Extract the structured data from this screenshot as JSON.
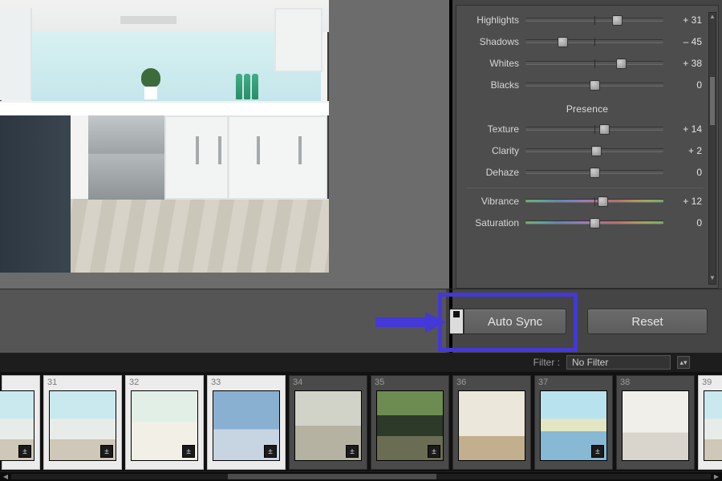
{
  "panel": {
    "groups": {
      "tone": {
        "highlights": {
          "label": "Highlights",
          "value": "+ 31",
          "pct": 66
        },
        "shadows": {
          "label": "Shadows",
          "value": "– 45",
          "pct": 27
        },
        "whites": {
          "label": "Whites",
          "value": "+ 38",
          "pct": 69
        },
        "blacks": {
          "label": "Blacks",
          "value": "0",
          "pct": 50
        }
      },
      "presence_title": "Presence",
      "presence": {
        "texture": {
          "label": "Texture",
          "value": "+ 14",
          "pct": 57
        },
        "clarity": {
          "label": "Clarity",
          "value": "+ 2",
          "pct": 51
        },
        "dehaze": {
          "label": "Dehaze",
          "value": "0",
          "pct": 50
        }
      },
      "color": {
        "vibrance": {
          "label": "Vibrance",
          "value": "+ 12",
          "pct": 56
        },
        "saturation": {
          "label": "Saturation",
          "value": "0",
          "pct": 50
        }
      }
    }
  },
  "actions": {
    "auto_sync": "Auto Sync",
    "reset": "Reset"
  },
  "filter": {
    "label": "Filter :",
    "value": "No Filter"
  },
  "filmstrip": {
    "items": [
      {
        "num": "",
        "sel": true,
        "scene": "sc-interior",
        "badge": true
      },
      {
        "num": "31",
        "sel": true,
        "scene": "sc-interior",
        "badge": true
      },
      {
        "num": "32",
        "sel": true,
        "scene": "sc-living",
        "badge": true
      },
      {
        "num": "33",
        "sel": true,
        "scene": "sc-blue",
        "badge": true
      },
      {
        "num": "34",
        "sel": false,
        "scene": "sc-room",
        "badge": true
      },
      {
        "num": "35",
        "sel": false,
        "scene": "sc-ext",
        "badge": true
      },
      {
        "num": "36",
        "sel": false,
        "scene": "sc-gallery",
        "badge": false
      },
      {
        "num": "37",
        "sel": false,
        "scene": "sc-lake",
        "badge": true
      },
      {
        "num": "38",
        "sel": false,
        "scene": "sc-white",
        "badge": false
      },
      {
        "num": "39",
        "sel": true,
        "scene": "sc-interior",
        "badge": false
      }
    ]
  },
  "icons": {
    "edit_badge": "±",
    "up": "▲",
    "down": "▼",
    "left": "◀",
    "right": "▶",
    "updown": "▴▾"
  }
}
